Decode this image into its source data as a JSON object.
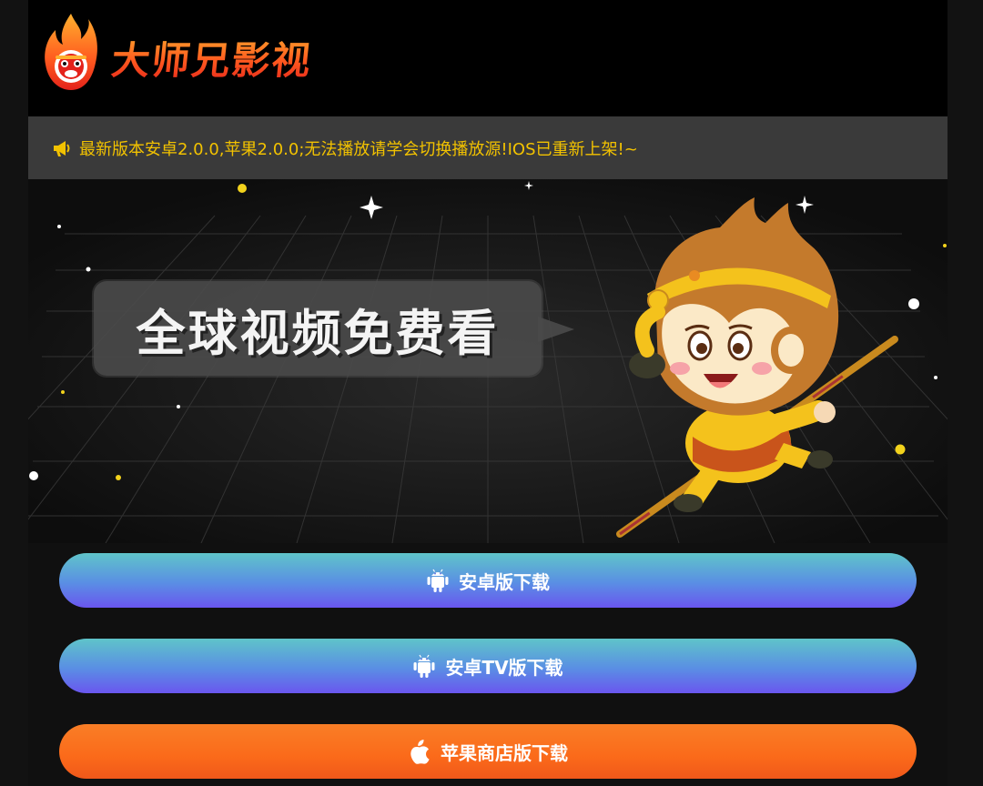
{
  "brand": {
    "name": "大师兄影视"
  },
  "notice": {
    "icon": "megaphone-icon",
    "text": "最新版本安卓2.0.0,苹果2.0.0;无法播放请学会切换播放源!IOS已重新上架!~",
    "color": "#f2c200"
  },
  "banner": {
    "slogan": "全球视频免费看"
  },
  "buttons": [
    {
      "label": "安卓版下载",
      "icon": "android-icon"
    },
    {
      "label": "安卓TV版下载",
      "icon": "android-icon"
    },
    {
      "label": "苹果商店版下载",
      "icon": "apple-icon"
    }
  ],
  "colors": {
    "page_bg": "#101010",
    "header_bg": "#000000",
    "notice_bg": "#3a3a3a",
    "brand_orange": "#ff5a1f",
    "button_blue_top": "#5fc4c9",
    "button_blue_bottom": "#6a56ef",
    "button_orange": "#f97e26"
  }
}
